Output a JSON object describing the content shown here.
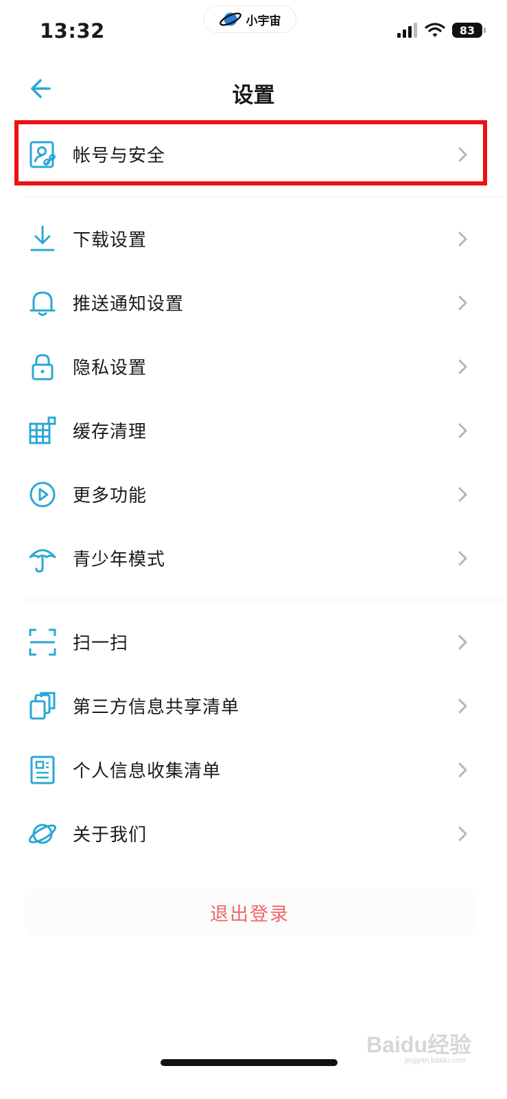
{
  "status_bar": {
    "time": "13:32",
    "app_pill_label": "小宇宙",
    "battery": "83",
    "icons": [
      "cellular-signal-icon",
      "wifi-icon",
      "battery-icon"
    ]
  },
  "nav": {
    "title": "设置",
    "back_icon": "arrow-left-icon"
  },
  "sections": [
    {
      "items": [
        {
          "label": "帐号与安全",
          "icon": "account-security-icon"
        }
      ]
    },
    {
      "items": [
        {
          "label": "下载设置",
          "icon": "download-icon"
        },
        {
          "label": "推送通知设置",
          "icon": "bell-icon"
        },
        {
          "label": "隐私设置",
          "icon": "lock-icon"
        },
        {
          "label": "缓存清理",
          "icon": "grid-icon"
        },
        {
          "label": "更多功能",
          "icon": "play-circle-icon"
        },
        {
          "label": "青少年模式",
          "icon": "umbrella-icon"
        }
      ]
    },
    {
      "items": [
        {
          "label": "扫一扫",
          "icon": "scan-icon"
        },
        {
          "label": "第三方信息共享清单",
          "icon": "copy-icon"
        },
        {
          "label": "个人信息收集清单",
          "icon": "document-icon"
        },
        {
          "label": "关于我们",
          "icon": "planet-icon"
        }
      ]
    }
  ],
  "logout_label": "退出登录",
  "watermark": {
    "text": "Baidu经验",
    "sub": "jingyan.baidu.com"
  },
  "colors": {
    "accent": "#2aa7d6",
    "highlight": "#ee1111",
    "logout": "#ee6666",
    "chevron": "#b5b5b5"
  }
}
